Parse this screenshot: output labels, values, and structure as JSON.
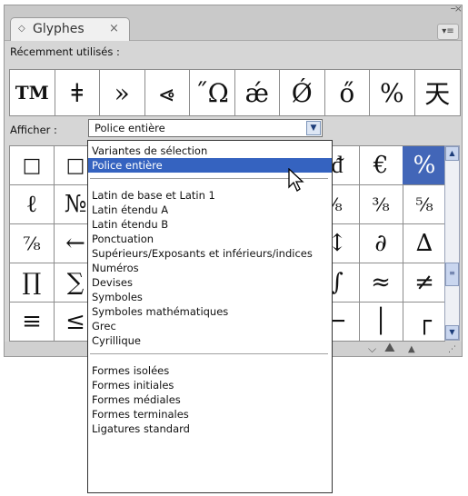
{
  "panel": {
    "tab_title": "Glyphes",
    "tab_mark": "◇",
    "tab_close": "×",
    "window_minimize": "–",
    "window_close": "×",
    "menu_glyph": "▾≡"
  },
  "recent": {
    "label": "Récemment utilisés :",
    "glyphs": [
      "TM",
      "ǂ",
      "»",
      "⩹",
      "˝Ω",
      "ǽ",
      "Ǿ",
      "ő",
      "%",
      "天"
    ]
  },
  "show": {
    "label": "Afficher :",
    "selected_value": "Police entière"
  },
  "grid": {
    "rows": [
      [
        "□",
        "□",
        "",
        "",
        "",
        "",
        "",
        "ᵭ",
        "€",
        "%"
      ],
      [
        "ℓ",
        "№",
        "",
        "",
        "",
        "",
        "",
        "⁄₈",
        "³⁄₈",
        "⁵⁄₈"
      ],
      [
        "⁷⁄₈",
        "←",
        "",
        "",
        "",
        "",
        "",
        "↕",
        "∂",
        "∆"
      ],
      [
        "∏",
        "∑",
        "",
        "",
        "",
        "",
        "",
        "∫",
        "≈",
        "≠"
      ],
      [
        "≡",
        "≤",
        "",
        "",
        "",
        "",
        "",
        "─",
        "│",
        "┌"
      ]
    ],
    "selected_cell": [
      0,
      9
    ]
  },
  "dropdown": {
    "groups": [
      [
        "Variantes de sélection",
        "Police entière"
      ],
      [
        "Latin de base et Latin 1",
        "Latin étendu A",
        "Latin étendu B",
        "Ponctuation",
        "Supérieurs/Exposants et inférieurs/indices",
        "Numéros",
        "Devises",
        "Symboles",
        "Symboles mathématiques",
        "Grec",
        "Cyrillique"
      ],
      [
        "Formes isolées",
        "Formes initiales",
        "Formes médiales",
        "Formes terminales",
        "Ligatures standard"
      ]
    ],
    "selected_item": "Police entière"
  },
  "colors": {
    "selection": "#3563c0",
    "selected_cell": "#4266b8",
    "panel_bg": "#d6d6d6"
  },
  "icons": {
    "tab_mark": "diamond-icon",
    "scroll_up": "chevron-up-icon",
    "scroll_down": "chevron-down-icon",
    "zoom_out": "small-mountain-icon",
    "zoom_in": "large-mountain-icon",
    "cursor": "arrow-cursor-icon"
  }
}
